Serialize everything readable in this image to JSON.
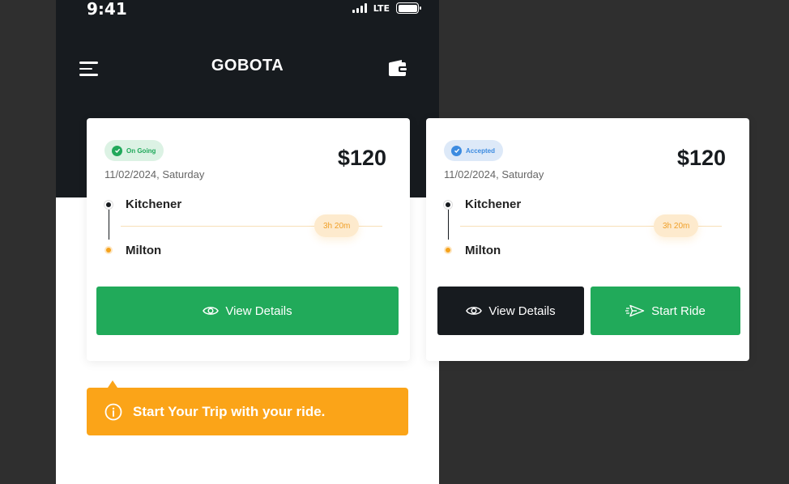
{
  "status_bar": {
    "time": "9:41",
    "network": "LTE",
    "signal_icon": "signal-icon",
    "battery_icon": "battery-icon"
  },
  "header": {
    "title": "GOBOTA",
    "menu_icon": "menu-icon",
    "wallet_icon": "wallet-icon"
  },
  "cards": [
    {
      "status": "On Going",
      "status_color": "#22a85b",
      "price": "$120",
      "date": "11/02/2024, Saturday",
      "from": "Kitchener",
      "to": "Milton",
      "duration": "3h 20m",
      "buttons": [
        {
          "label": "View Details",
          "icon": "eye-icon",
          "color": "#21aa5a"
        }
      ]
    },
    {
      "status": "Accepted",
      "status_color": "#3c8be0",
      "price": "$120",
      "date": "11/02/2024, Saturday",
      "from": "Kitchener",
      "to": "Milton",
      "duration": "3h 20m",
      "buttons": [
        {
          "label": "View Details",
          "icon": "eye-icon",
          "color": "#171b1f"
        },
        {
          "label": "Start Ride",
          "icon": "send-icon",
          "color": "#21aa5a"
        }
      ]
    }
  ],
  "tooltip": {
    "text": "Start Your Trip with your ride.",
    "icon": "info-icon",
    "color": "#fba418"
  }
}
